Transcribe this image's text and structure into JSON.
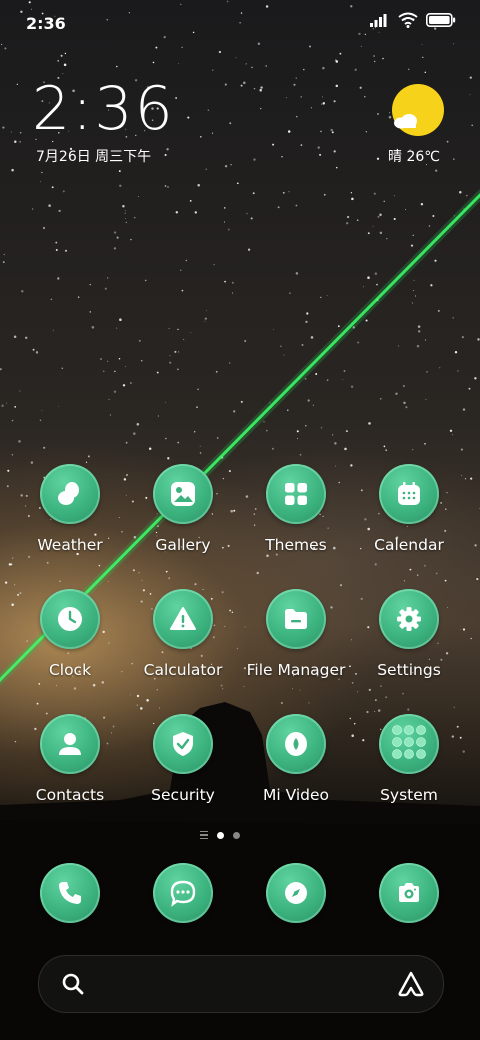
{
  "status_bar": {
    "time": "2:36"
  },
  "lock_widget": {
    "time": "2:36",
    "date": "7月26日 周三下午",
    "weather": "晴 26℃"
  },
  "apps": [
    {
      "label": "Weather",
      "icon": "weather-icon"
    },
    {
      "label": "Gallery",
      "icon": "gallery-icon"
    },
    {
      "label": "Themes",
      "icon": "themes-icon"
    },
    {
      "label": "Calendar",
      "icon": "calendar-icon"
    },
    {
      "label": "Clock",
      "icon": "clock-icon"
    },
    {
      "label": "Calculator",
      "icon": "calculator-icon"
    },
    {
      "label": "File Manager",
      "icon": "file-manager-icon"
    },
    {
      "label": "Settings",
      "icon": "settings-icon"
    },
    {
      "label": "Contacts",
      "icon": "contacts-icon"
    },
    {
      "label": "Security",
      "icon": "security-icon"
    },
    {
      "label": "Mi Video",
      "icon": "mi-video-icon"
    },
    {
      "label": "System",
      "icon": "system-folder-icon"
    }
  ],
  "dock": [
    {
      "icon": "phone-icon"
    },
    {
      "icon": "messages-icon"
    },
    {
      "icon": "browser-compass-icon"
    },
    {
      "icon": "camera-icon"
    }
  ],
  "page_indicator": {
    "pages": 2,
    "current": 1
  },
  "colors": {
    "icon_green": "#3cb37f",
    "sun": "#f7d21a",
    "laser": "#3dff6a"
  }
}
